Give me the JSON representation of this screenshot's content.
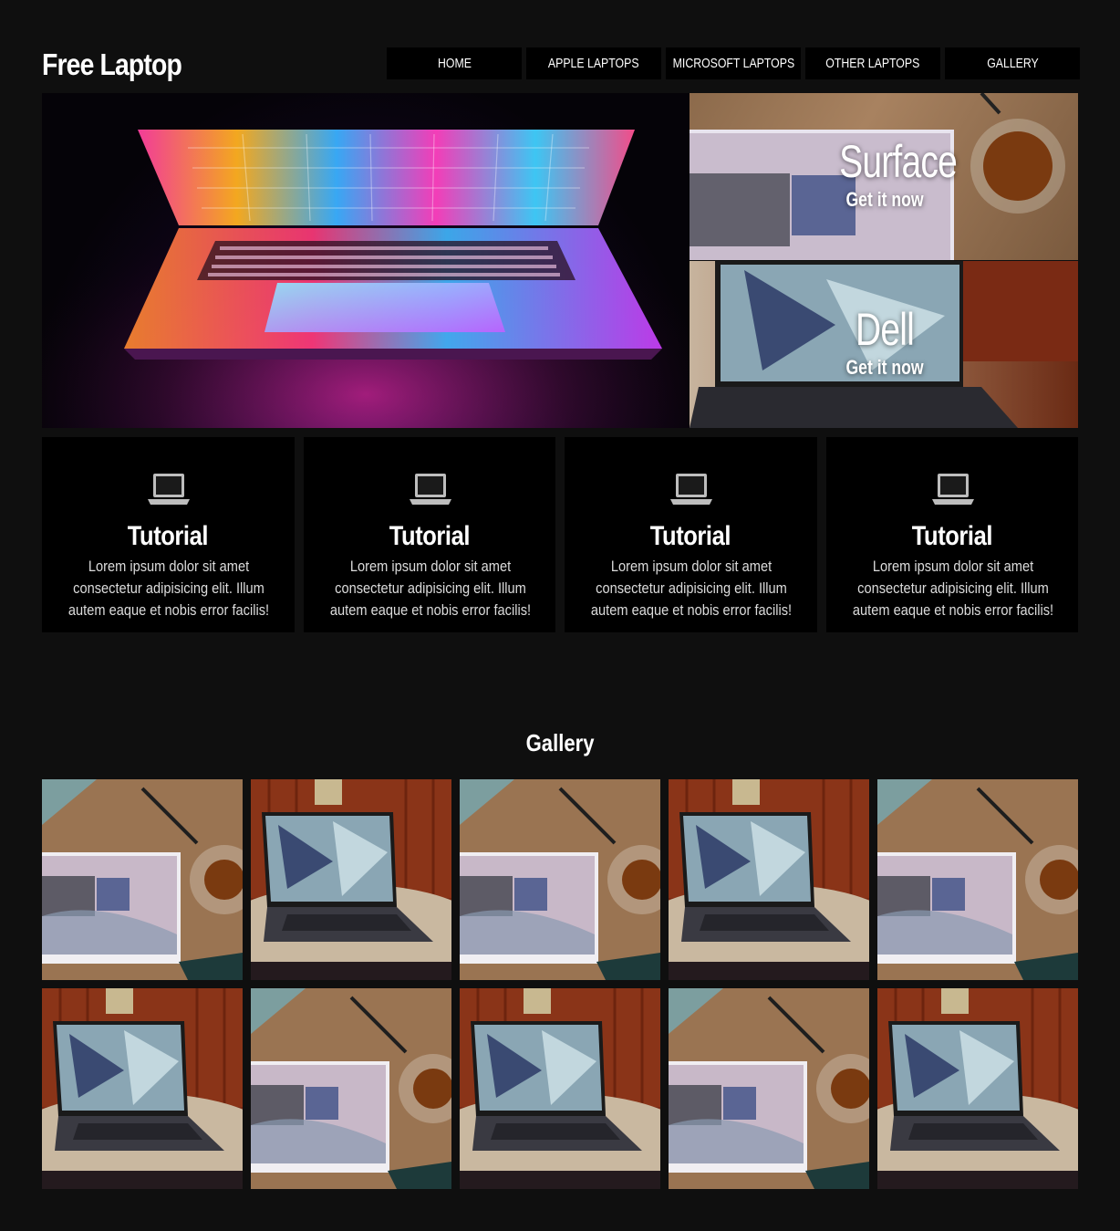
{
  "brand": "Free Laptop",
  "nav": [
    {
      "label": "HOME"
    },
    {
      "label": "APPLE LAPTOPS"
    },
    {
      "label": "MICROSOFT LAPTOPS"
    },
    {
      "label": "OTHER LAPTOPS"
    },
    {
      "label": "GALLERY"
    }
  ],
  "hero": {
    "promos": [
      {
        "title": "Surface",
        "cta": "Get it now"
      },
      {
        "title": "Dell",
        "cta": "Get it now"
      }
    ]
  },
  "features": [
    {
      "icon": "laptop-icon",
      "title": "Tutorial",
      "text": "Lorem ipsum dolor sit amet consectetur adipisicing elit. Illum autem eaque et nobis error facilis!"
    },
    {
      "icon": "laptop-icon",
      "title": "Tutorial",
      "text": "Lorem ipsum dolor sit amet consectetur adipisicing elit. Illum autem eaque et nobis error facilis!"
    },
    {
      "icon": "laptop-icon",
      "title": "Tutorial",
      "text": "Lorem ipsum dolor sit amet consectetur adipisicing elit. Illum autem eaque et nobis error facilis!"
    },
    {
      "icon": "laptop-icon",
      "title": "Tutorial",
      "text": "Lorem ipsum dolor sit amet consectetur adipisicing elit. Illum autem eaque et nobis error facilis!"
    }
  ],
  "gallery": {
    "title": "Gallery",
    "tiles": [
      "surface",
      "dell",
      "surface",
      "dell",
      "surface",
      "dell",
      "surface",
      "dell",
      "surface",
      "dell"
    ]
  },
  "colors": {
    "background": "#0f0f0f",
    "panel": "#000000",
    "text": "#ffffff"
  }
}
